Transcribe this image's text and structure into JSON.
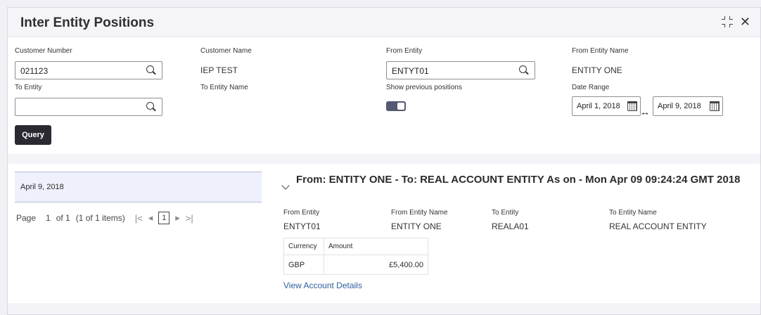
{
  "window": {
    "title": "Inter Entity Positions"
  },
  "form": {
    "customer_number": {
      "label": "Customer Number",
      "value": "021123"
    },
    "customer_name": {
      "label": "Customer Name",
      "value": "IEP TEST"
    },
    "from_entity": {
      "label": "From Entity",
      "value": "ENTYT01"
    },
    "from_entity_name": {
      "label": "From Entity Name",
      "value": "ENTITY ONE"
    },
    "to_entity": {
      "label": "To Entity",
      "value": ""
    },
    "to_entity_name": {
      "label": "To Entity Name"
    },
    "show_previous": {
      "label": "Show previous positions",
      "on": true
    },
    "date_range": {
      "label": "Date Range",
      "from": "April 1, 2018",
      "to": "April 9, 2018",
      "separator": "↔"
    },
    "query_button": "Query"
  },
  "list": {
    "items": [
      "April 9, 2018"
    ]
  },
  "pager": {
    "page_label": "Page",
    "page": "1",
    "of": "of 1",
    "items": "(1 of 1 items)",
    "current": "1",
    "first": "|<",
    "prev": "◂",
    "next": "▸",
    "last": ">|"
  },
  "detail": {
    "title": "From: ENTITY ONE - To: REAL ACCOUNT ENTITY As on - Mon Apr 09 09:24:24 GMT 2018",
    "columns": [
      {
        "label": "From Entity",
        "value": "ENTYT01"
      },
      {
        "label": "From Entity Name",
        "value": "ENTITY ONE"
      },
      {
        "label": "To Entity",
        "value": "REALA01"
      },
      {
        "label": "To Entity Name",
        "value": "REAL ACCOUNT ENTITY"
      }
    ],
    "table": {
      "headers": [
        "Currency",
        "Amount"
      ],
      "rows": [
        [
          "GBP",
          "£5,400.00"
        ]
      ]
    },
    "link": "View Account Details"
  }
}
